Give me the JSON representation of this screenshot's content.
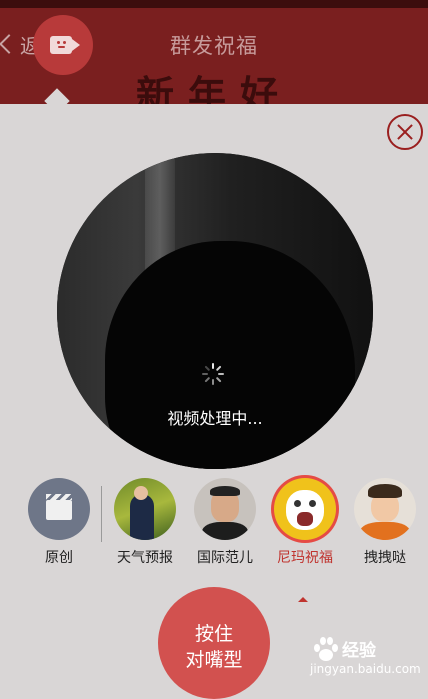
{
  "header": {
    "back_label": "返",
    "title": "群发祝福",
    "banner_text": "新年好"
  },
  "preview": {
    "status_text": "视频处理中..."
  },
  "filters": [
    {
      "label": "原创",
      "icon": "clapperboard-icon"
    },
    {
      "label": "天气预报",
      "icon": "weather-presenter-avatar"
    },
    {
      "label": "国际范儿",
      "icon": "man-portrait-avatar"
    },
    {
      "label": "尼玛祝福",
      "icon": "nima-cartoon-avatar",
      "selected": true
    },
    {
      "label": "拽拽哒",
      "icon": "boy-portrait-avatar"
    }
  ],
  "record_button": {
    "line1": "按住",
    "line2": "对嘴型"
  },
  "watermark": {
    "brand": "经验",
    "url": "jingyan.baidu.com"
  },
  "colors": {
    "accent": "#d2514f",
    "active_label": "#c0342f",
    "close": "#9a1f1f"
  }
}
